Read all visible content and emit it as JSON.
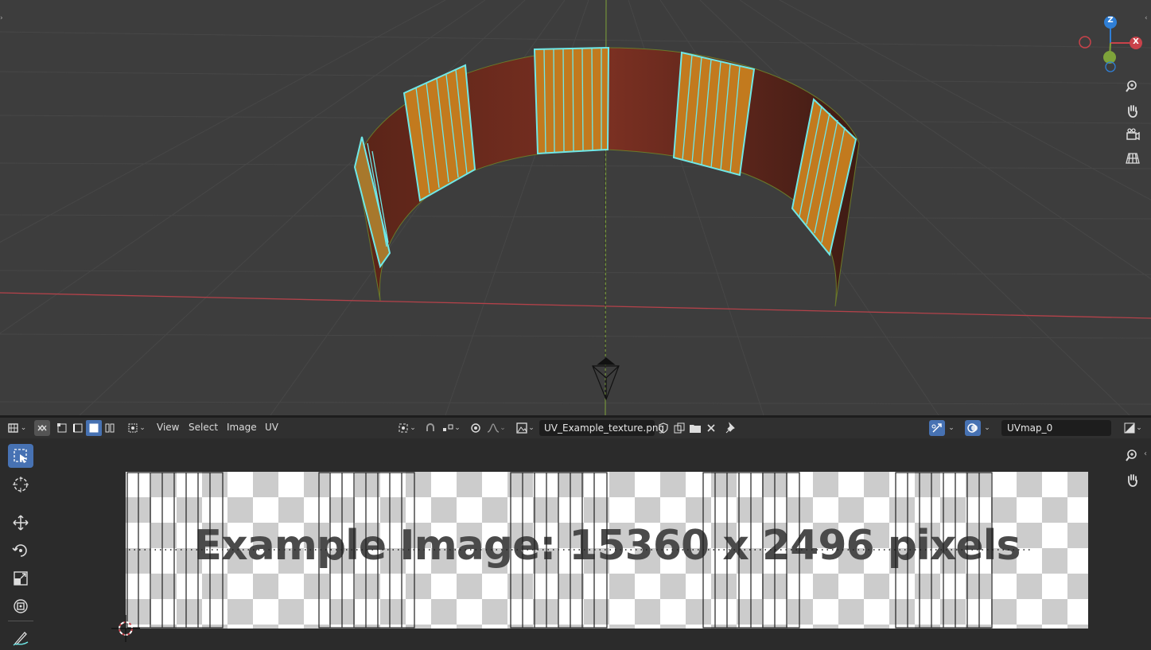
{
  "header": {
    "menus": [
      "View",
      "Select",
      "Image",
      "UV"
    ],
    "image_name": "UV_Example_texture.png",
    "uv_map": "UVmap_0"
  },
  "uv_editor": {
    "image_text": "Example Image: 15360 x 2496 pixels"
  },
  "gizmo": {
    "z_label": "Z",
    "x_label": "X"
  },
  "colors": {
    "selection_edge": "#6fe8e8",
    "x_axis": "#c9424a",
    "y_axis": "#7ea33a",
    "z_axis": "#2f7fd6",
    "active_tool": "#4772b3",
    "mesh_face": "#7a2e1f"
  }
}
